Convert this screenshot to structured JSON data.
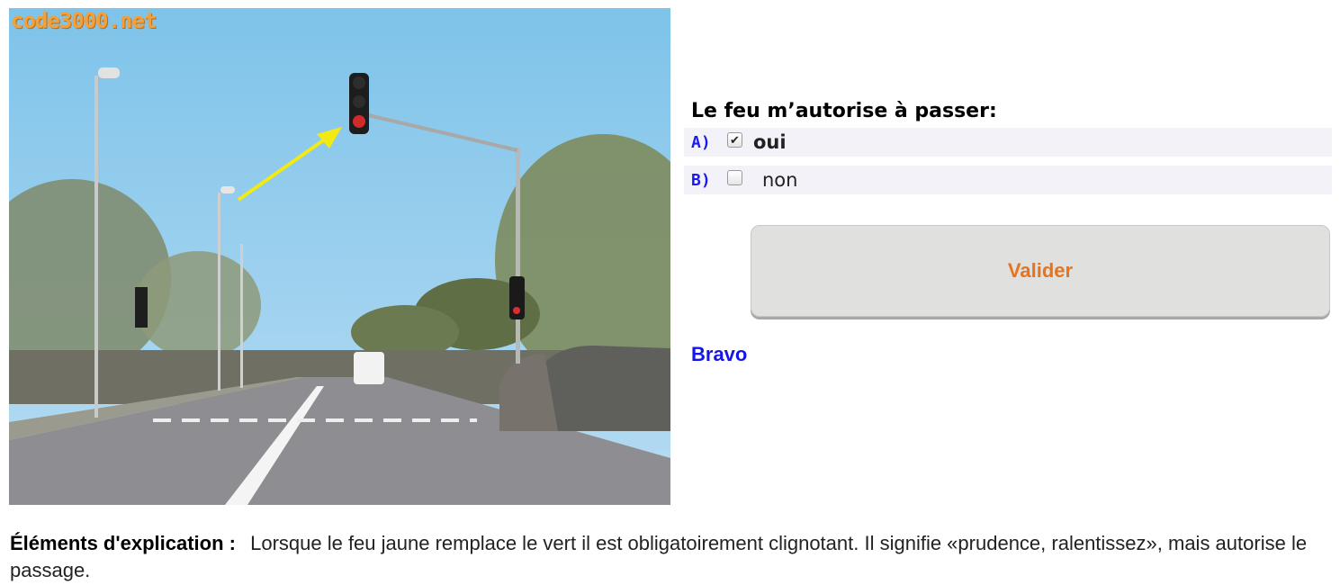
{
  "watermark": "code3000.net",
  "question": "Le feu m’autorise à passer:",
  "answers": [
    {
      "letter": "A)",
      "label": "oui",
      "checked": true
    },
    {
      "letter": "B)",
      "label": "non",
      "checked": false
    }
  ],
  "submit_label": "Valider",
  "feedback": "Bravo",
  "explanation": {
    "label": "Éléments d'explication :",
    "text": "Lorsque le feu jaune remplace le vert il est obligatoirement clignotant. Il signifie «prudence, ralentissez», mais autorise le passage."
  },
  "colors": {
    "letter": "#1a1aee",
    "submit_text": "#e8731e",
    "feedback": "#1515e8",
    "answer_row_bg": "#f2f2f8",
    "watermark": "#f0a03c"
  }
}
